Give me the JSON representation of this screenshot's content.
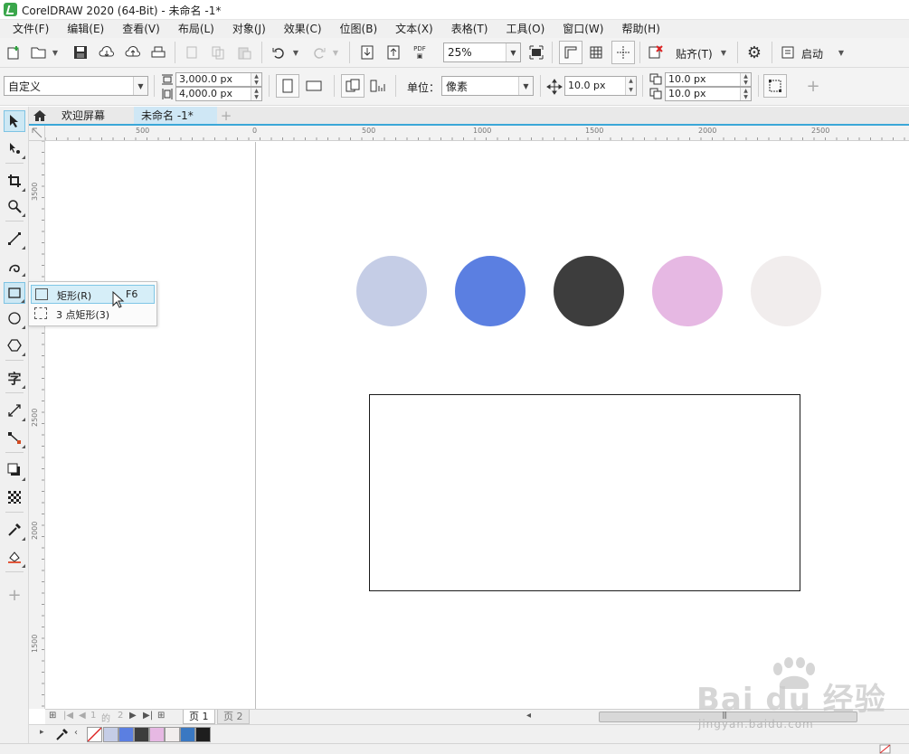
{
  "window": {
    "title": "CorelDRAW 2020 (64-Bit) - 未命名 -1*"
  },
  "menu": [
    "文件(F)",
    "编辑(E)",
    "查看(V)",
    "布局(L)",
    "对象(J)",
    "效果(C)",
    "位图(B)",
    "文本(X)",
    "表格(T)",
    "工具(O)",
    "窗口(W)",
    "帮助(H)"
  ],
  "std_toolbar": {
    "zoom_value": "25%",
    "pdf_label": "PDF",
    "snap_label": "贴齐(T)",
    "launch_label": "启动"
  },
  "prop_bar": {
    "page_preset": "自定义",
    "width": "3,000.0 px",
    "height": "4,000.0 px",
    "units_label": "单位：",
    "units_value": "像素",
    "nudge": "10.0 px",
    "dup_x": "10.0 px",
    "dup_y": "10.0 px"
  },
  "tabs": {
    "welcome": "欢迎屏幕",
    "document": "未命名 -1*",
    "add": "+"
  },
  "rulers": {
    "h_labels": [
      "500",
      "0",
      "500",
      "1000",
      "1500",
      "2000",
      "2500"
    ],
    "v_labels": [
      "3500",
      "3000",
      "2500",
      "2000",
      "1500"
    ]
  },
  "canvas": {
    "circle_colors": [
      "#c5cde6",
      "#5b7fe1",
      "#3d3d3d",
      "#e6b8e3",
      "#f1eded"
    ]
  },
  "flyout": {
    "items": [
      {
        "label": "矩形(R)",
        "shortcut": "F6"
      },
      {
        "label": "3 点矩形(3)",
        "shortcut": ""
      }
    ]
  },
  "pager": {
    "current": "1",
    "of": "的",
    "total": "2",
    "page1": "页 1",
    "page2": "页 2"
  },
  "palette": {
    "colors": [
      "#c5cde6",
      "#5b7fe1",
      "#3d3d3d",
      "#e6b8e3",
      "#f1eded",
      "#3a78c2",
      "#1e1e1e"
    ]
  },
  "watermark": {
    "brand": "Bai du 经验",
    "url": "jingyan.baidu.com"
  }
}
